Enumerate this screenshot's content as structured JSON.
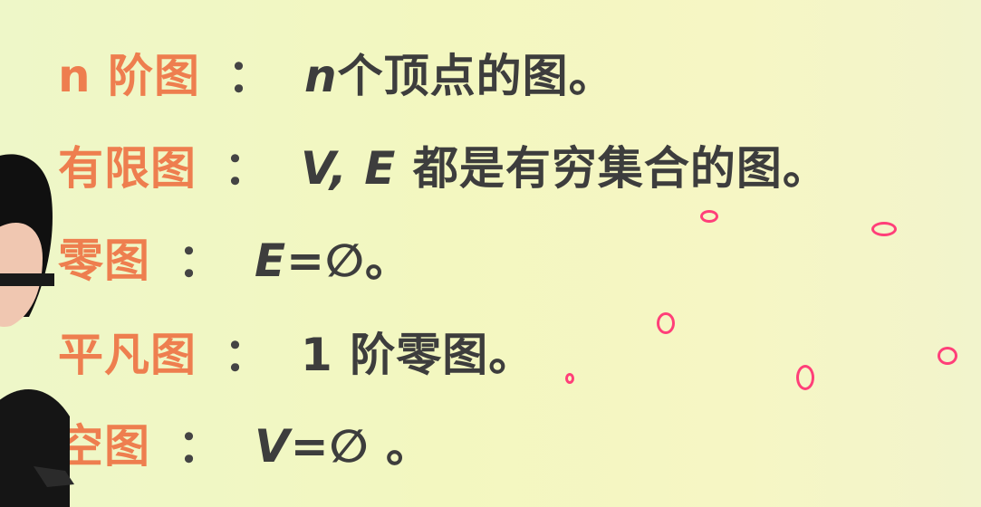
{
  "slide": {
    "rows": [
      {
        "term": "n 阶图",
        "colon": "：",
        "def_math": "n",
        "def": "个顶点的图。"
      },
      {
        "term": "有限图",
        "colon": "：",
        "def_math": "V, E",
        "def": "都是有穷集合的图。"
      },
      {
        "term": "零图",
        "colon": "：",
        "def_math": "E",
        "def": "=∅。"
      },
      {
        "term": "平凡图",
        "colon": "：",
        "def_math": "",
        "def": "1 阶零图。"
      },
      {
        "term": "空图",
        "colon": "：",
        "def_math": "V",
        "def": "=∅ 。"
      }
    ]
  },
  "colors": {
    "term": "#ee7e4f",
    "text": "#3d3d3d",
    "annotation": "#ff3f79",
    "background": "#f3f7c0"
  },
  "icons": {
    "annotation_marks": "hand-drawn-circle-marks",
    "presenter": "person-silhouette"
  }
}
